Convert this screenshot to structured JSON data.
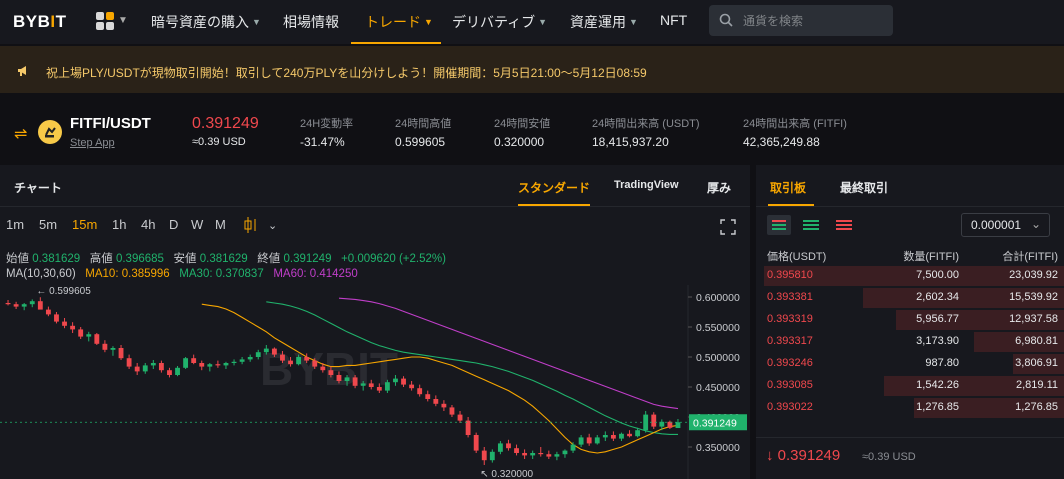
{
  "nav": {
    "logo_left": "BYB",
    "logo_i": "I",
    "logo_right": "T",
    "items": [
      {
        "label": "暗号資産の購入",
        "caret": true
      },
      {
        "label": "相場情報",
        "caret": false
      },
      {
        "label": "トレード",
        "caret": true,
        "active": true
      },
      {
        "label": "デリバティブ",
        "caret": true
      },
      {
        "label": "資産運用",
        "caret": true
      },
      {
        "label": "NFT",
        "caret": false
      }
    ],
    "search_placeholder": "通貨を検索"
  },
  "banner": {
    "text": "祝上場PLY/USDTが現物取引開始！取引して240万PLYを山分けしよう！開催期間：5月5日21:00〜5月12日08:59"
  },
  "ticker": {
    "pair": "FITFI/USDT",
    "subtitle": "Step App",
    "price": "0.391249",
    "price_usd": "≈0.39 USD",
    "stats": [
      {
        "label": "24H変動率",
        "value": "-31.47%",
        "negative": true
      },
      {
        "label": "24時間高値",
        "value": "0.599605"
      },
      {
        "label": "24時間安値",
        "value": "0.320000"
      },
      {
        "label": "24時間出来高 (USDT)",
        "value": "18,415,937.20"
      },
      {
        "label": "24時間出来高 (FITFI)",
        "value": "42,365,249.88"
      }
    ]
  },
  "chart_panel": {
    "title": "チャート",
    "tabs": [
      "スタンダード",
      "TradingView",
      "厚み"
    ],
    "intervals": [
      "1m",
      "5m",
      "15m",
      "1h",
      "4h",
      "D",
      "W",
      "M"
    ],
    "active_interval": "15m",
    "ohlc": {
      "open_label": "始値",
      "open": "0.381629",
      "high_label": "高値",
      "high": "0.396685",
      "low_label": "安値",
      "low": "0.381629",
      "close_label": "終値",
      "close": "0.391249",
      "change": "+0.009620 (+2.52%)"
    },
    "ma": {
      "label": "MA(10,30,60)",
      "ma10_label": "MA10:",
      "ma10": "0.385996",
      "ma30_label": "MA30:",
      "ma30": "0.370837",
      "ma60_label": "MA60:",
      "ma60": "0.414250"
    },
    "watermark": "BYBIT"
  },
  "chart_data": {
    "type": "candlestick",
    "ylim": [
      0.32,
      0.62
    ],
    "y_ticks": [
      "0.600000",
      "0.550000",
      "0.500000",
      "0.450000",
      "0.400000",
      "0.350000"
    ],
    "current_price_label": "0.391249",
    "high_marker": "0.599605",
    "low_marker": "0.320000",
    "colors": {
      "up": "#20b26c",
      "down": "#f0484d",
      "ma10": "#f7a600",
      "ma30": "#20b26c",
      "ma60": "#c03ec9"
    },
    "candles": [
      [
        0.59,
        0.595,
        0.586,
        0.588
      ],
      [
        0.588,
        0.592,
        0.58,
        0.584
      ],
      [
        0.584,
        0.59,
        0.578,
        0.588
      ],
      [
        0.588,
        0.596,
        0.583,
        0.593
      ],
      [
        0.593,
        0.5996,
        0.585,
        0.579
      ],
      [
        0.579,
        0.584,
        0.568,
        0.571
      ],
      [
        0.571,
        0.575,
        0.556,
        0.559
      ],
      [
        0.559,
        0.565,
        0.548,
        0.552
      ],
      [
        0.552,
        0.558,
        0.54,
        0.546
      ],
      [
        0.546,
        0.55,
        0.53,
        0.534
      ],
      [
        0.534,
        0.542,
        0.526,
        0.538
      ],
      [
        0.538,
        0.54,
        0.52,
        0.522
      ],
      [
        0.522,
        0.528,
        0.508,
        0.512
      ],
      [
        0.512,
        0.518,
        0.502,
        0.515
      ],
      [
        0.515,
        0.52,
        0.495,
        0.498
      ],
      [
        0.498,
        0.504,
        0.48,
        0.484
      ],
      [
        0.484,
        0.49,
        0.47,
        0.476
      ],
      [
        0.476,
        0.49,
        0.472,
        0.486
      ],
      [
        0.486,
        0.495,
        0.48,
        0.49
      ],
      [
        0.49,
        0.494,
        0.474,
        0.478
      ],
      [
        0.478,
        0.482,
        0.466,
        0.47
      ],
      [
        0.47,
        0.485,
        0.468,
        0.482
      ],
      [
        0.482,
        0.5,
        0.48,
        0.498
      ],
      [
        0.498,
        0.504,
        0.488,
        0.49
      ],
      [
        0.49,
        0.494,
        0.478,
        0.484
      ],
      [
        0.484,
        0.49,
        0.476,
        0.488
      ],
      [
        0.488,
        0.494,
        0.482,
        0.486
      ],
      [
        0.486,
        0.492,
        0.48,
        0.49
      ],
      [
        0.49,
        0.496,
        0.486,
        0.492
      ],
      [
        0.492,
        0.5,
        0.488,
        0.496
      ],
      [
        0.496,
        0.504,
        0.492,
        0.5
      ],
      [
        0.5,
        0.512,
        0.496,
        0.508
      ],
      [
        0.508,
        0.52,
        0.504,
        0.514
      ],
      [
        0.514,
        0.516,
        0.5,
        0.504
      ],
      [
        0.504,
        0.51,
        0.49,
        0.494
      ],
      [
        0.494,
        0.5,
        0.484,
        0.488
      ],
      [
        0.488,
        0.504,
        0.486,
        0.5
      ],
      [
        0.5,
        0.506,
        0.49,
        0.494
      ],
      [
        0.494,
        0.498,
        0.48,
        0.484
      ],
      [
        0.484,
        0.49,
        0.474,
        0.478
      ],
      [
        0.478,
        0.484,
        0.466,
        0.47
      ],
      [
        0.47,
        0.476,
        0.456,
        0.46
      ],
      [
        0.46,
        0.47,
        0.452,
        0.466
      ],
      [
        0.466,
        0.47,
        0.448,
        0.452
      ],
      [
        0.452,
        0.46,
        0.444,
        0.456
      ],
      [
        0.456,
        0.462,
        0.446,
        0.45
      ],
      [
        0.45,
        0.456,
        0.44,
        0.444
      ],
      [
        0.444,
        0.462,
        0.44,
        0.458
      ],
      [
        0.458,
        0.47,
        0.452,
        0.464
      ],
      [
        0.464,
        0.468,
        0.45,
        0.454
      ],
      [
        0.454,
        0.46,
        0.444,
        0.448
      ],
      [
        0.448,
        0.454,
        0.434,
        0.438
      ],
      [
        0.438,
        0.444,
        0.426,
        0.43
      ],
      [
        0.43,
        0.436,
        0.418,
        0.422
      ],
      [
        0.422,
        0.428,
        0.41,
        0.416
      ],
      [
        0.416,
        0.42,
        0.4,
        0.404
      ],
      [
        0.404,
        0.41,
        0.39,
        0.394
      ],
      [
        0.394,
        0.4,
        0.366,
        0.37
      ],
      [
        0.37,
        0.374,
        0.34,
        0.344
      ],
      [
        0.344,
        0.35,
        0.32,
        0.328
      ],
      [
        0.328,
        0.346,
        0.324,
        0.342
      ],
      [
        0.342,
        0.36,
        0.338,
        0.356
      ],
      [
        0.356,
        0.362,
        0.344,
        0.348
      ],
      [
        0.348,
        0.354,
        0.336,
        0.34
      ],
      [
        0.34,
        0.346,
        0.33,
        0.336
      ],
      [
        0.336,
        0.344,
        0.33,
        0.34
      ],
      [
        0.34,
        0.35,
        0.334,
        0.338
      ],
      [
        0.338,
        0.344,
        0.33,
        0.334
      ],
      [
        0.334,
        0.342,
        0.328,
        0.338
      ],
      [
        0.338,
        0.346,
        0.332,
        0.344
      ],
      [
        0.344,
        0.358,
        0.34,
        0.354
      ],
      [
        0.354,
        0.37,
        0.35,
        0.366
      ],
      [
        0.366,
        0.372,
        0.352,
        0.356
      ],
      [
        0.356,
        0.37,
        0.354,
        0.366
      ],
      [
        0.366,
        0.376,
        0.36,
        0.37
      ],
      [
        0.37,
        0.376,
        0.36,
        0.364
      ],
      [
        0.364,
        0.374,
        0.36,
        0.372
      ],
      [
        0.372,
        0.378,
        0.366,
        0.368
      ],
      [
        0.368,
        0.382,
        0.366,
        0.378
      ],
      [
        0.378,
        0.41,
        0.374,
        0.404
      ],
      [
        0.404,
        0.408,
        0.38,
        0.384
      ],
      [
        0.384,
        0.396,
        0.378,
        0.392
      ],
      [
        0.392,
        0.394,
        0.38,
        0.382
      ],
      [
        0.381629,
        0.396685,
        0.381629,
        0.391249
      ]
    ],
    "ma10": [
      0.588,
      0.586,
      0.584,
      0.58,
      0.574,
      0.566,
      0.558,
      0.55,
      0.542,
      0.532,
      0.524,
      0.516,
      0.508,
      0.5,
      0.494,
      0.488,
      0.484,
      0.484,
      0.486,
      0.486,
      0.488,
      0.49,
      0.492,
      0.494,
      0.496,
      0.498,
      0.5,
      0.5,
      0.498,
      0.494,
      0.49,
      0.486,
      0.48,
      0.474,
      0.468,
      0.462,
      0.456,
      0.45,
      0.444,
      0.436,
      0.428,
      0.418,
      0.406,
      0.394,
      0.38,
      0.366,
      0.354,
      0.346,
      0.342,
      0.34,
      0.342,
      0.346,
      0.35,
      0.356,
      0.362,
      0.368,
      0.374,
      0.38,
      0.384,
      0.386
    ],
    "ma30": [
      0.592,
      0.59,
      0.588,
      0.585,
      0.581,
      0.576,
      0.57,
      0.563,
      0.556,
      0.549,
      0.542,
      0.536,
      0.53,
      0.524,
      0.519,
      0.515,
      0.511,
      0.508,
      0.506,
      0.504,
      0.502,
      0.5,
      0.498,
      0.496,
      0.494,
      0.492,
      0.49,
      0.487,
      0.484,
      0.48,
      0.476,
      0.471,
      0.466,
      0.461,
      0.455,
      0.449,
      0.443,
      0.436,
      0.43,
      0.423,
      0.416,
      0.409,
      0.402,
      0.396,
      0.39,
      0.385,
      0.381,
      0.377,
      0.374,
      0.372,
      0.371,
      0.371
    ],
    "ma60": [
      0.598,
      0.597,
      0.596,
      0.594,
      0.592,
      0.589,
      0.585,
      0.581,
      0.576,
      0.571,
      0.566,
      0.561,
      0.556,
      0.551,
      0.546,
      0.541,
      0.536,
      0.531,
      0.526,
      0.521,
      0.516,
      0.511,
      0.506,
      0.501,
      0.496,
      0.491,
      0.486,
      0.481,
      0.476,
      0.471,
      0.466,
      0.461,
      0.456,
      0.451,
      0.446,
      0.441,
      0.436,
      0.431,
      0.426,
      0.421,
      0.418,
      0.416,
      0.414
    ]
  },
  "book": {
    "tabs": [
      "取引板",
      "最終取引"
    ],
    "decimals": "0.000001",
    "headers": [
      "価格(USDT)",
      "数量(FITFI)",
      "合計(FITFI)"
    ],
    "asks": [
      {
        "price": "0.395810",
        "qty": "7,500.00",
        "total": "23,039.92",
        "depth": 1.0
      },
      {
        "price": "0.393381",
        "qty": "2,602.34",
        "total": "15,539.92",
        "depth": 0.67
      },
      {
        "price": "0.393319",
        "qty": "5,956.77",
        "total": "12,937.58",
        "depth": 0.56
      },
      {
        "price": "0.393317",
        "qty": "3,173.90",
        "total": "6,980.81",
        "depth": 0.3
      },
      {
        "price": "0.393246",
        "qty": "987.80",
        "total": "3,806.91",
        "depth": 0.17
      },
      {
        "price": "0.393085",
        "qty": "1,542.26",
        "total": "2,819.11",
        "depth": 0.6
      },
      {
        "price": "0.393022",
        "qty": "1,276.85",
        "total": "1,276.85",
        "depth": 0.5
      }
    ],
    "last_price": "0.391249",
    "last_usd": "≈0.39 USD"
  }
}
